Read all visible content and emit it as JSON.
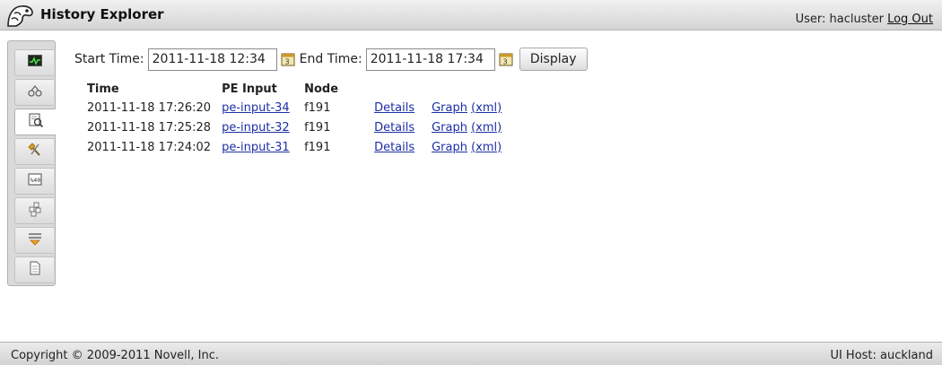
{
  "header": {
    "title": "History Explorer",
    "user_prefix": "User:",
    "username": "hacluster",
    "logout_label": "Log Out"
  },
  "sidebar": {
    "items": [
      {
        "icon": "monitor-icon",
        "active": false
      },
      {
        "icon": "nodes-icon",
        "active": false
      },
      {
        "icon": "history-icon",
        "active": true
      },
      {
        "icon": "tools-icon",
        "active": false
      },
      {
        "icon": "attributes-icon",
        "active": false
      },
      {
        "icon": "resources-icon",
        "active": false
      },
      {
        "icon": "constraints-icon",
        "active": false
      },
      {
        "icon": "document-icon",
        "active": false
      }
    ]
  },
  "form": {
    "start_label": "Start Time:",
    "start_value": "2011-11-18 12:34",
    "end_label": "End Time:",
    "end_value": "2011-11-18 17:34",
    "display_label": "Display"
  },
  "table": {
    "headers": [
      "Time",
      "PE Input",
      "Node"
    ],
    "rows": [
      {
        "time": "2011-11-18 17:26:20",
        "pe_input": "pe-input-34",
        "node": "f191",
        "details": "Details",
        "graph": "Graph",
        "xml": "(xml)"
      },
      {
        "time": "2011-11-18 17:25:28",
        "pe_input": "pe-input-32",
        "node": "f191",
        "details": "Details",
        "graph": "Graph",
        "xml": "(xml)"
      },
      {
        "time": "2011-11-18 17:24:02",
        "pe_input": "pe-input-31",
        "node": "f191",
        "details": "Details",
        "graph": "Graph",
        "xml": "(xml)"
      }
    ]
  },
  "footer": {
    "copyright": "Copyright © 2009-2011 Novell, Inc.",
    "ui_host": "UI Host: auckland"
  },
  "colors": {
    "link": "#1c2fa6",
    "header_bg": "#dcdcdc",
    "sidebar_bg": "#dadada"
  }
}
